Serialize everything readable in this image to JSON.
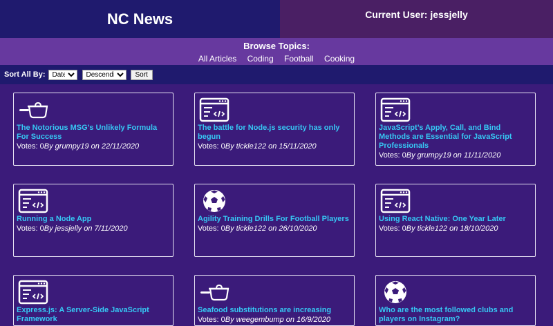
{
  "header": {
    "brand": "NC News",
    "user_label": "Current User: jessjelly"
  },
  "topics": {
    "title": "Browse Topics:",
    "links": [
      "All Articles",
      "Coding",
      "Football",
      "Cooking"
    ]
  },
  "sort": {
    "label": "Sort All By:",
    "field_value": "Date",
    "order_value": "Descending",
    "button": "Sort"
  },
  "articles": [
    {
      "icon": "cooking-pan-icon",
      "title": "The Notorious MSG’s Unlikely Formula For Success",
      "votes": "Votes: 0",
      "byline": "By grumpy19 on 22/11/2020"
    },
    {
      "icon": "code-window-icon",
      "title": "The battle for Node.js security has only begun",
      "votes": "Votes: 0",
      "byline": "By tickle122 on 15/11/2020"
    },
    {
      "icon": "code-window-icon",
      "title": "JavaScript’s Apply, Call, and Bind Methods are Essential for JavaScript Professionals",
      "votes": "Votes: 0",
      "byline": "By grumpy19 on 11/11/2020"
    },
    {
      "icon": "code-window-icon",
      "title": "Running a Node App",
      "votes": "Votes: 0",
      "byline": "By jessjelly on 7/11/2020"
    },
    {
      "icon": "football-icon",
      "title": "Agility Training Drills For Football Players",
      "votes": "Votes: 0",
      "byline": "By tickle122 on 26/10/2020"
    },
    {
      "icon": "code-window-icon",
      "title": "Using React Native: One Year Later",
      "votes": "Votes: 0",
      "byline": "By tickle122 on 18/10/2020"
    },
    {
      "icon": "code-window-icon",
      "title": "Express.js: A Server-Side JavaScript Framework",
      "votes": "",
      "byline": ""
    },
    {
      "icon": "cooking-pan-icon",
      "title": "Seafood substitutions are increasing",
      "votes": "Votes: 0",
      "byline": "By weegembump on 16/9/2020"
    },
    {
      "icon": "football-icon",
      "title": "Who are the most followed clubs and players on Instagram?",
      "votes": "",
      "byline": ""
    }
  ]
}
